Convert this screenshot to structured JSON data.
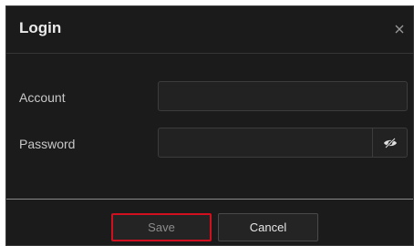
{
  "dialog": {
    "title": "Login",
    "close_icon": "close-icon"
  },
  "form": {
    "account": {
      "label": "Account",
      "value": ""
    },
    "password": {
      "label": "Password",
      "value": "",
      "toggle_icon": "eye-slash-icon"
    }
  },
  "footer": {
    "save_label": "Save",
    "cancel_label": "Cancel"
  },
  "colors": {
    "background": "#1b1b1b",
    "save_highlight": "#d0101e"
  }
}
